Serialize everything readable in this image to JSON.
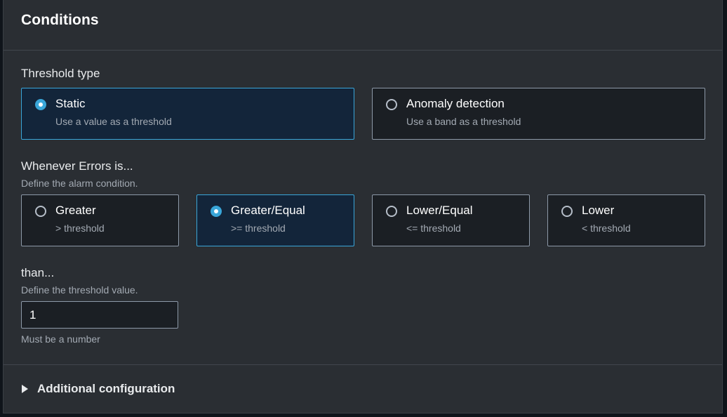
{
  "header": {
    "title": "Conditions"
  },
  "threshold_type": {
    "label": "Threshold type",
    "options": [
      {
        "title": "Static",
        "subtitle": "Use a value as a threshold",
        "selected": true
      },
      {
        "title": "Anomaly detection",
        "subtitle": "Use a band as a threshold",
        "selected": false
      }
    ]
  },
  "condition": {
    "label": "Whenever Errors is...",
    "description": "Define the alarm condition.",
    "options": [
      {
        "title": "Greater",
        "subtitle": "> threshold",
        "selected": false
      },
      {
        "title": "Greater/Equal",
        "subtitle": ">= threshold",
        "selected": true
      },
      {
        "title": "Lower/Equal",
        "subtitle": "<= threshold",
        "selected": false
      },
      {
        "title": "Lower",
        "subtitle": "< threshold",
        "selected": false
      }
    ]
  },
  "threshold_value": {
    "label": "than...",
    "description": "Define the threshold value.",
    "value": "1",
    "hint": "Must be a number"
  },
  "additional": {
    "label": "Additional configuration",
    "icon": "caret-right-icon"
  },
  "colors": {
    "accent": "#39a6d9",
    "panel_background": "#2a2e33",
    "tile_selected_background": "#13253a"
  }
}
